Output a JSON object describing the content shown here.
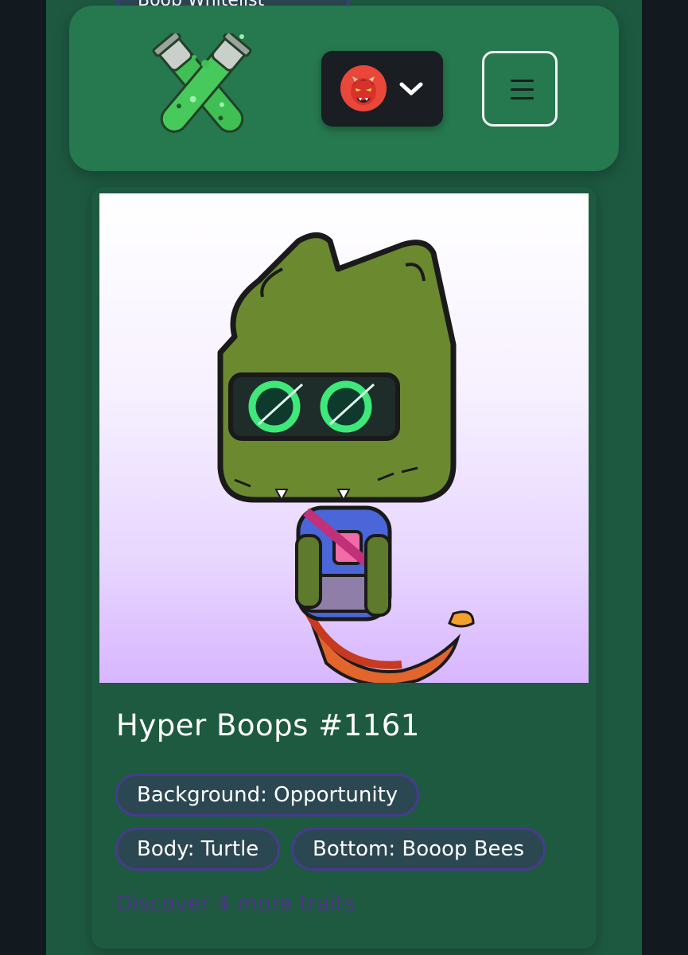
{
  "header": {
    "peek_chip_label": "Boop Whitelist",
    "logo_alt": "X test-tube logo",
    "wallet_avatar_icon": "red-demon-avatar",
    "wallet_chevron_icon": "chevron-down-icon",
    "menu_icon": "hamburger-menu-icon"
  },
  "nft": {
    "image_icon": "nft-cat-character",
    "title": "Hyper Boops #1161",
    "traits": [
      {
        "label": "Background: Opportunity"
      },
      {
        "label": "Body: Turtle"
      },
      {
        "label": "Bottom: Booop Bees"
      }
    ],
    "discover_link": "Discover 4 more traits"
  },
  "colors": {
    "page_bg": "#121a1f",
    "column_bg": "#1d5940",
    "header_bg": "#26784f",
    "wallet_bg": "#1a1d21",
    "chip_bg": "#2b4752",
    "chip_border": "#483a8f",
    "link_color": "#4d348a"
  }
}
